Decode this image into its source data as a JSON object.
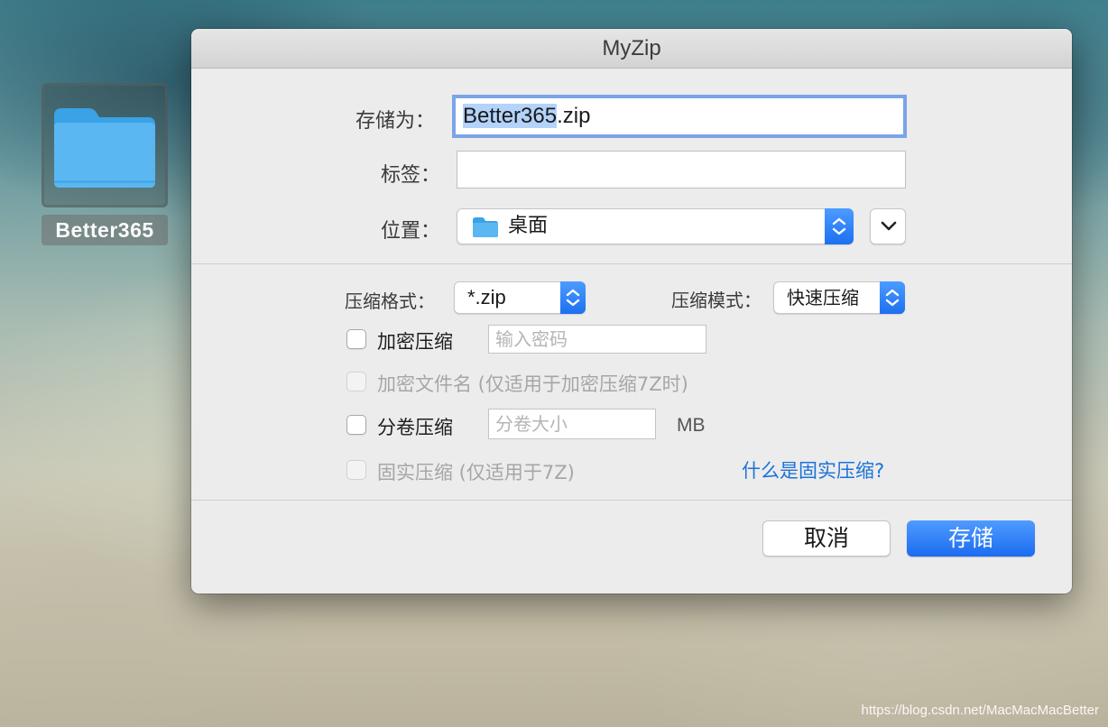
{
  "desktop": {
    "folder_name": "Better365",
    "watermark": "https://blog.csdn.net/MacMacMacBetter"
  },
  "dialog": {
    "title": "MyZip",
    "save_as": {
      "label": "存储为：",
      "selected_part": "Better365",
      "rest_part": ".zip"
    },
    "tags": {
      "label": "标签：",
      "value": ""
    },
    "location": {
      "label": "位置：",
      "value": "桌面",
      "icon": "folder-icon"
    },
    "format": {
      "label": "压缩格式：",
      "value": "*.zip"
    },
    "mode": {
      "label": "压缩模式：",
      "value": "快速压缩"
    },
    "encrypt": {
      "label": "加密压缩",
      "checked": false,
      "placeholder": "输入密码"
    },
    "encrypt_filenames": {
      "label": "加密文件名 (仅适用于加密压缩7Z时)",
      "checked": false,
      "enabled": false
    },
    "split": {
      "label": "分卷压缩",
      "checked": false,
      "placeholder": "分卷大小",
      "unit": "MB"
    },
    "solid": {
      "label": "固实压缩 (仅适用于7Z)",
      "checked": false,
      "enabled": false
    },
    "solid_help_link": "什么是固实压缩?",
    "cancel_label": "取消",
    "save_label": "存储"
  },
  "colors": {
    "accent": "#1d6ff0",
    "link": "#1a73d9",
    "folder_blue": "#5ab7f2"
  }
}
